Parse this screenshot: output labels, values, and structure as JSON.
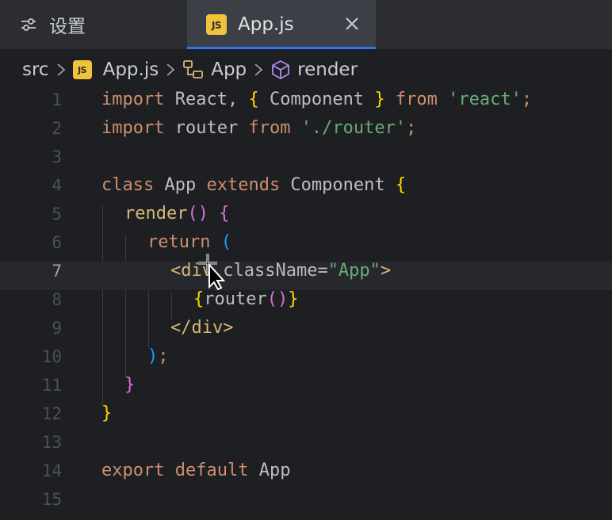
{
  "tabs": [
    {
      "label": "设置",
      "icon": "gear-icon"
    },
    {
      "label": "App.js",
      "icon": "js-file-icon",
      "badge": "JS",
      "active": true
    }
  ],
  "breadcrumb": {
    "items": [
      {
        "label": "src"
      },
      {
        "label": "App.js",
        "badge": "JS"
      },
      {
        "label": "App",
        "icon": "class-icon"
      },
      {
        "label": "render",
        "icon": "method-icon"
      }
    ]
  },
  "editor": {
    "current_line": 7,
    "line_numbers": [
      "1",
      "2",
      "3",
      "4",
      "5",
      "6",
      "7",
      "8",
      "9",
      "10",
      "11",
      "12",
      "13",
      "14",
      "15"
    ],
    "tokens": {
      "l1": [
        "import",
        " React, ",
        "{",
        " Component ",
        "}",
        " ",
        "from",
        " ",
        "'react'",
        ";"
      ],
      "l2": [
        "import",
        " router ",
        "from",
        " ",
        "'./router'",
        ";"
      ],
      "l4": [
        "class",
        " App ",
        "extends",
        " Component ",
        "{"
      ],
      "l5": [
        "render",
        "()",
        " ",
        "{"
      ],
      "l6": [
        "return",
        " ",
        "("
      ],
      "l7": [
        "<div",
        " className",
        "=",
        "\"App\"",
        ">"
      ],
      "l8": [
        "{",
        "router",
        "()",
        "}"
      ],
      "l9": [
        "</div>"
      ],
      "l10": [
        ")",
        ";"
      ],
      "l11": [
        "}"
      ],
      "l12": [
        "}"
      ],
      "l14": [
        "export",
        " ",
        "default",
        " App"
      ]
    }
  },
  "colors": {
    "keyword": "#cf8e6d",
    "string": "#6aab73",
    "tag": "#d5b778",
    "bracket_gold": "#ffd700",
    "bracket_magenta": "#da70d6",
    "bracket_blue": "#179fff",
    "tab_underline": "#3574f0"
  }
}
